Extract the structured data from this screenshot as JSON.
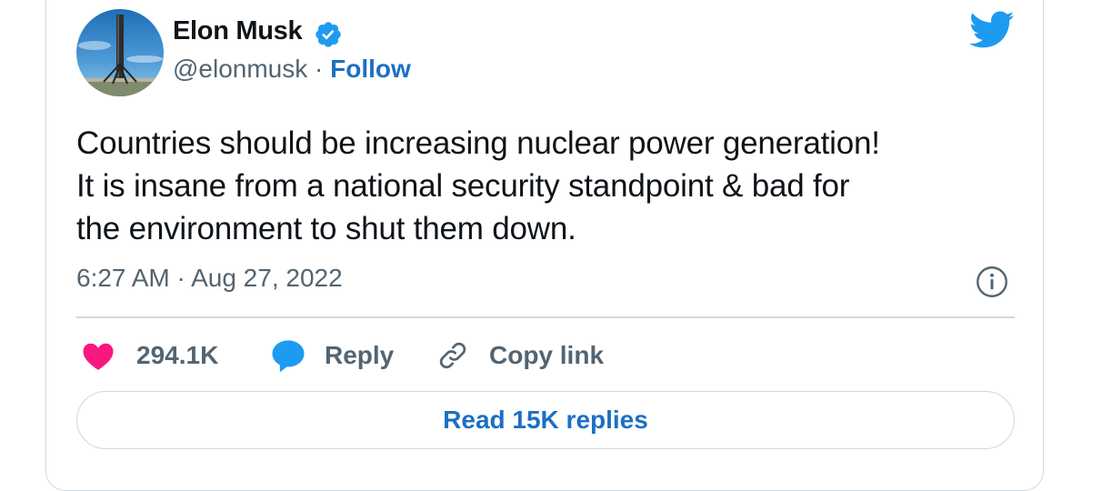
{
  "author": {
    "name": "Elon Musk",
    "handle": "@elonmusk",
    "separator": " · ",
    "follow_label": "Follow",
    "verified": true
  },
  "tweet": {
    "lines": [
      "Countries should be increasing nuclear power generation!",
      "It is insane from a national security standpoint & bad for",
      "the environment to shut them down."
    ],
    "timestamp": "6:27 AM · Aug 27, 2022"
  },
  "actions": {
    "like_count": "294.1K",
    "reply_label": "Reply",
    "copy_link_label": "Copy link"
  },
  "footer": {
    "read_replies_label": "Read 15K replies"
  },
  "icons": {
    "brand": "twitter-bird-icon",
    "verified": "verified-badge-icon",
    "info": "info-icon",
    "like": "heart-icon",
    "reply": "speech-bubble-icon",
    "copy_link": "link-icon"
  },
  "colors": {
    "brand_blue": "#1d9bf0",
    "link_blue": "#1d6fc4",
    "like_pink": "#f91880",
    "text_primary": "#0f1419",
    "text_secondary": "#536471",
    "border": "#cfd9de"
  }
}
